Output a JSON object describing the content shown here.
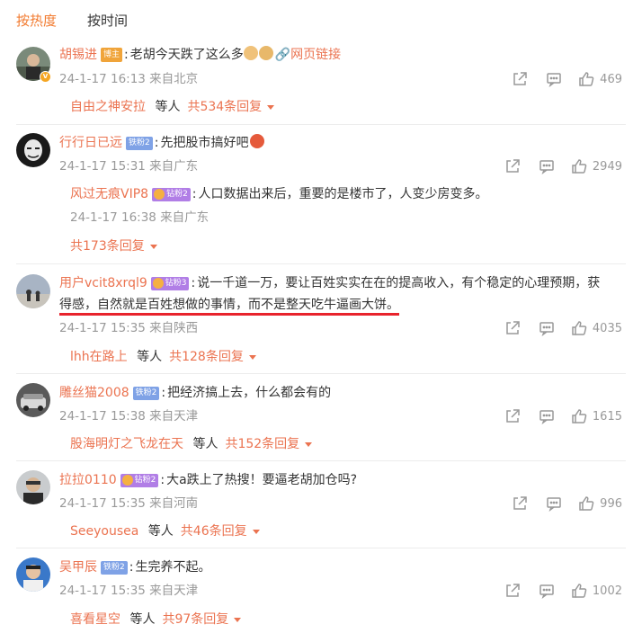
{
  "tabs": [
    {
      "label": "按热度"
    },
    {
      "label": "按时间"
    }
  ],
  "comments": [
    {
      "user": "胡锡进",
      "badge": "博主",
      "text": "老胡今天跌了这么多",
      "link_label": "网页链接",
      "meta": "24-1-17 16:13 来自北京",
      "likes": "469",
      "reply_users": "自由之神安拉",
      "reply_mid": "等人",
      "reply_count": "共534条回复"
    },
    {
      "user": "行行日已远",
      "badge": "铁粉2",
      "text": "先把股市搞好吧",
      "meta": "24-1-17 15:31 来自广东",
      "likes": "2949",
      "sub_reply": {
        "user": "风过无痕VIP8",
        "badge": "钻粉2",
        "text": "人口数据出来后，重要的是楼市了，人变少房变多。",
        "meta": "24-1-17 16:38 来自广东"
      },
      "reply_count": "共173条回复"
    },
    {
      "user": "用户vcit8xrql9",
      "badge": "钻粉3",
      "text_line1": "说一千道一万，要让百姓实实在在的提高收入，有个稳定的心理预期，获",
      "text_line2": "得感，自然就是百姓想做的事情，而不是整天吃牛逼画大饼。",
      "meta": "24-1-17 15:35 来自陕西",
      "likes": "4035",
      "reply_users": "lhh在路上",
      "reply_mid": "等人",
      "reply_count": "共128条回复"
    },
    {
      "user": "雕丝猫2008",
      "badge": "铁粉2",
      "text": "把经济搞上去，什么都会有的",
      "meta": "24-1-17 15:38 来自天津",
      "likes": "1615",
      "reply_users": "股海明灯之飞龙在天",
      "reply_mid": "等人",
      "reply_count": "共152条回复"
    },
    {
      "user": "拉拉0110",
      "badge": "钻粉2",
      "text": "大a跌上了热搜！要逼老胡加仓吗?",
      "meta": "24-1-17 15:35 来自河南",
      "likes": "996",
      "reply_users": "Seeyousea",
      "reply_mid": "等人",
      "reply_count": "共46条回复"
    },
    {
      "user": "吴甲辰",
      "badge": "铁粉2",
      "text": "生完养不起。",
      "meta": "24-1-17 15:35 来自天津",
      "likes": "1002",
      "reply_users": "喜看星空",
      "reply_mid": "等人",
      "reply_count": "共97条回复"
    }
  ],
  "icons": {
    "share": "share-icon",
    "comment": "comment-icon",
    "like": "like-icon"
  },
  "colors": {
    "accent": "#f27b30",
    "username": "#eb7350",
    "meta": "#999999",
    "highlight_underline": "#e8232c"
  }
}
